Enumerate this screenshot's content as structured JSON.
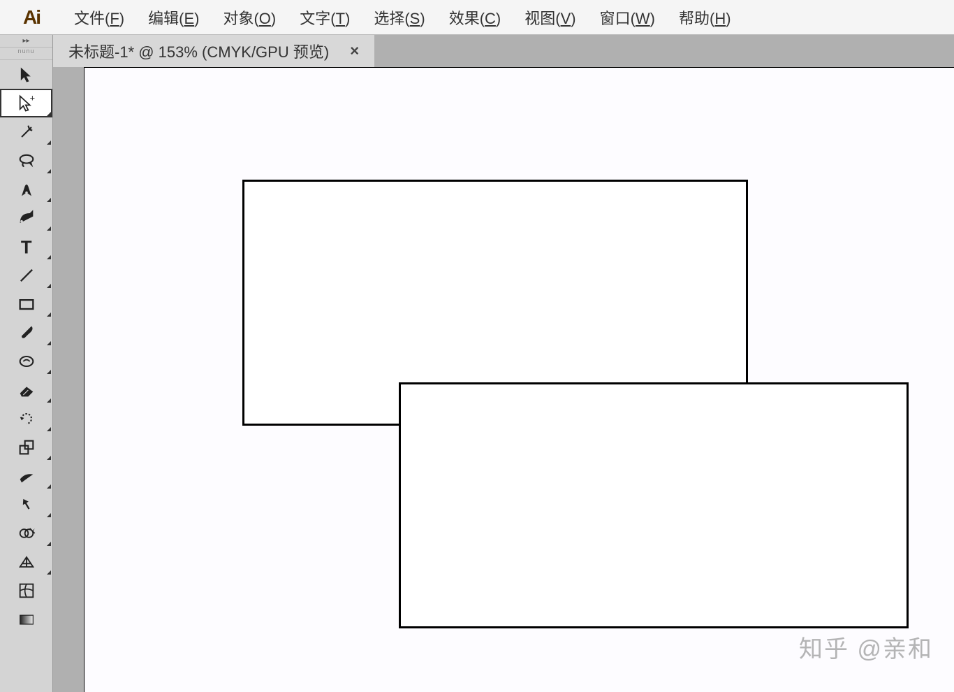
{
  "app": {
    "logo": "Ai"
  },
  "menu": {
    "items": [
      {
        "label": "文件(",
        "key": "F",
        "tail": ")"
      },
      {
        "label": "编辑(",
        "key": "E",
        "tail": ")"
      },
      {
        "label": "对象(",
        "key": "O",
        "tail": ")"
      },
      {
        "label": "文字(",
        "key": "T",
        "tail": ")"
      },
      {
        "label": "选择(",
        "key": "S",
        "tail": ")"
      },
      {
        "label": "效果(",
        "key": "C",
        "tail": ")"
      },
      {
        "label": "视图(",
        "key": "V",
        "tail": ")"
      },
      {
        "label": "窗口(",
        "key": "W",
        "tail": ")"
      },
      {
        "label": "帮助(",
        "key": "H",
        "tail": ")"
      }
    ]
  },
  "toolbox": {
    "dock_toggle": "▸▸",
    "strip_label": "nunu",
    "tools": [
      {
        "name": "selection-tool",
        "selected": false,
        "hasSub": false
      },
      {
        "name": "direct-selection-tool",
        "selected": true,
        "hasSub": true
      },
      {
        "name": "magic-wand-tool",
        "selected": false,
        "hasSub": true
      },
      {
        "name": "lasso-tool",
        "selected": false,
        "hasSub": true
      },
      {
        "name": "pen-tool",
        "selected": false,
        "hasSub": true
      },
      {
        "name": "curvature-tool",
        "selected": false,
        "hasSub": true
      },
      {
        "name": "type-tool",
        "selected": false,
        "hasSub": true
      },
      {
        "name": "line-segment-tool",
        "selected": false,
        "hasSub": true
      },
      {
        "name": "rectangle-tool",
        "selected": false,
        "hasSub": true
      },
      {
        "name": "paintbrush-tool",
        "selected": false,
        "hasSub": true
      },
      {
        "name": "shaper-tool",
        "selected": false,
        "hasSub": true
      },
      {
        "name": "eraser-tool",
        "selected": false,
        "hasSub": true
      },
      {
        "name": "rotate-tool",
        "selected": false,
        "hasSub": true
      },
      {
        "name": "scale-tool",
        "selected": false,
        "hasSub": true
      },
      {
        "name": "width-tool",
        "selected": false,
        "hasSub": true
      },
      {
        "name": "free-transform-tool",
        "selected": false,
        "hasSub": true
      },
      {
        "name": "shape-builder-tool",
        "selected": false,
        "hasSub": true
      },
      {
        "name": "perspective-grid-tool",
        "selected": false,
        "hasSub": true
      },
      {
        "name": "mesh-tool",
        "selected": false,
        "hasSub": false
      },
      {
        "name": "gradient-tool",
        "selected": false,
        "hasSub": false
      }
    ]
  },
  "document": {
    "tab_title": "未标题-1* @ 153% (CMYK/GPU 预览)",
    "close": "×"
  },
  "canvas": {
    "shapes": [
      {
        "name": "rect1"
      },
      {
        "name": "rect2"
      }
    ]
  },
  "watermark": "知乎 @亲和"
}
